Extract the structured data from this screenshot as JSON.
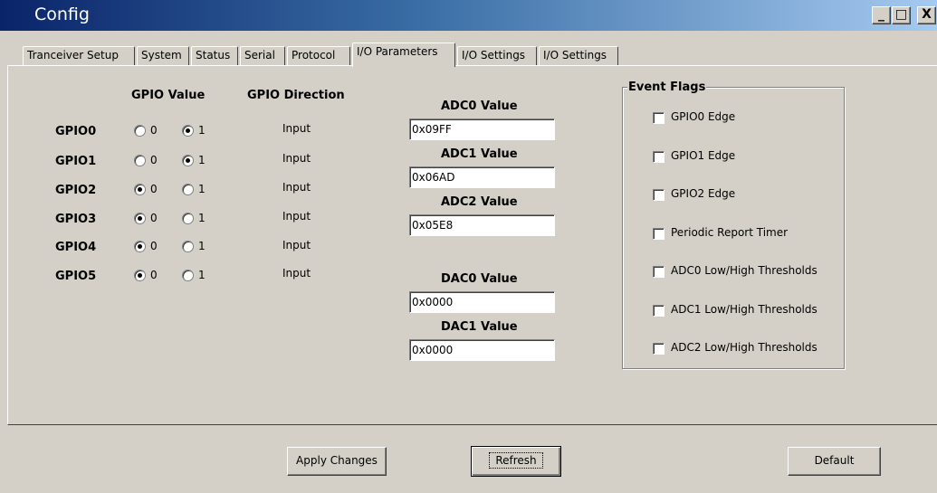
{
  "window": {
    "title": "Config",
    "minimize": "_",
    "maximize": "□",
    "close": "X"
  },
  "tabs": [
    {
      "label": "Tranceiver Setup"
    },
    {
      "label": "System"
    },
    {
      "label": "Status"
    },
    {
      "label": "Serial"
    },
    {
      "label": "Protocol"
    },
    {
      "label": "I/O Parameters",
      "active": true
    },
    {
      "label": "I/O Settings"
    },
    {
      "label": "I/O Settings"
    }
  ],
  "gpio": {
    "value_header": "GPIO Value",
    "direction_header": "GPIO Direction",
    "rows": [
      {
        "name": "GPIO0",
        "opt0": "0",
        "opt1": "1",
        "selected": "1",
        "direction": "Input"
      },
      {
        "name": "GPIO1",
        "opt0": "0",
        "opt1": "1",
        "selected": "1",
        "direction": "Input"
      },
      {
        "name": "GPIO2",
        "opt0": "0",
        "opt1": "1",
        "selected": "0",
        "direction": "Input"
      },
      {
        "name": "GPIO3",
        "opt0": "0",
        "opt1": "1",
        "selected": "0",
        "direction": "Input"
      },
      {
        "name": "GPIO4",
        "opt0": "0",
        "opt1": "1",
        "selected": "0",
        "direction": "Input"
      },
      {
        "name": "GPIO5",
        "opt0": "0",
        "opt1": "1",
        "selected": "0",
        "direction": "Input"
      }
    ]
  },
  "adc": [
    {
      "label": "ADC0 Value",
      "value": "0x09FF"
    },
    {
      "label": "ADC1 Value",
      "value": "0x06AD"
    },
    {
      "label": "ADC2 Value",
      "value": "0x05E8"
    }
  ],
  "dac": [
    {
      "label": "DAC0 Value",
      "value": "0x0000"
    },
    {
      "label": "DAC1 Value",
      "value": "0x0000"
    }
  ],
  "event_flags": {
    "title": "Event Flags",
    "items": [
      {
        "label": "GPIO0 Edge",
        "checked": false
      },
      {
        "label": "GPIO1 Edge",
        "checked": false
      },
      {
        "label": "GPIO2 Edge",
        "checked": false
      },
      {
        "label": "Periodic Report Timer",
        "checked": false
      },
      {
        "label": "ADC0 Low/High Thresholds",
        "checked": false
      },
      {
        "label": "ADC1 Low/High Thresholds",
        "checked": false
      },
      {
        "label": "ADC2 Low/High Thresholds",
        "checked": false
      }
    ]
  },
  "buttons": {
    "apply": "Apply Changes",
    "refresh": "Refresh",
    "default": "Default"
  },
  "colors": {
    "face": "#d4d0c8",
    "title_start": "#0a246a",
    "title_end": "#a6caf0"
  }
}
